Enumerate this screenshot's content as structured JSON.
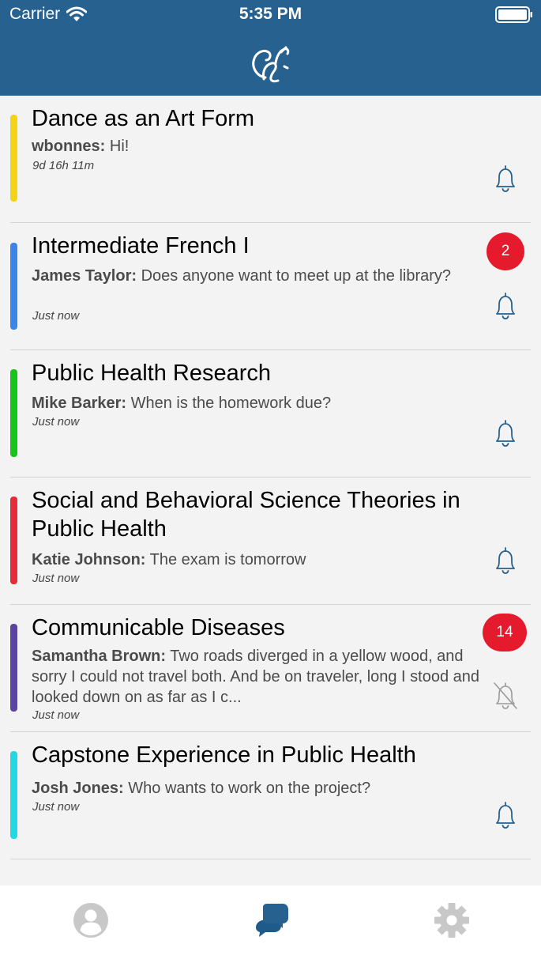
{
  "status_bar": {
    "carrier": "Carrier",
    "time": "5:35 PM"
  },
  "colors": {
    "header": "#266190",
    "badge": "#e51b2d",
    "bell": "#266190",
    "muted_bell": "#9a9a9a",
    "tab_inactive": "#c8c8c8",
    "tab_active": "#266190"
  },
  "header": {
    "logo_icon": "squirrel-logo-icon"
  },
  "conversations": [
    {
      "title": "Dance as an Art Form",
      "sender": "wbonnes:",
      "message": " Hi!",
      "time": "9d 16h 11m",
      "badge": "",
      "color": "#f2d414",
      "bell": "bell-icon"
    },
    {
      "title": "Intermediate French I",
      "sender": "James Taylor:",
      "message": " Does anyone want to meet up at the library?",
      "time": "Just now",
      "badge": "2",
      "color": "#3a85ea",
      "bell": "bell-icon"
    },
    {
      "title": "Public Health Research",
      "sender": "Mike Barker:",
      "message": " When is the homework due?",
      "time": "Just now",
      "badge": "",
      "color": "#16c41a",
      "bell": "bell-icon"
    },
    {
      "title": "Social and Behavioral Science Theories in Public Health",
      "sender": "Katie Johnson:",
      "message": " The exam is tomorrow",
      "time": "Just now",
      "badge": "",
      "color": "#e52d3a",
      "bell": "bell-icon"
    },
    {
      "title": "Communicable Diseases",
      "sender": "Samantha Brown:",
      "message": " Two roads diverged in a yellow wood, and sorry I could not travel both. And be on traveler, long I stood and looked down on as far as I c...",
      "time": "Just now",
      "badge": "14",
      "color": "#5b43a5",
      "bell": "bell-muted-icon"
    },
    {
      "title": "Capstone Experience in Public Health",
      "sender": "Josh Jones:",
      "message": " Who wants to work on the project?",
      "time": "Just now",
      "badge": "",
      "color": "#23d8e1",
      "bell": "bell-icon"
    }
  ],
  "tabs": [
    {
      "icon": "profile-icon",
      "active": false
    },
    {
      "icon": "chat-bubbles-icon",
      "active": true
    },
    {
      "icon": "gear-icon",
      "active": false
    }
  ]
}
